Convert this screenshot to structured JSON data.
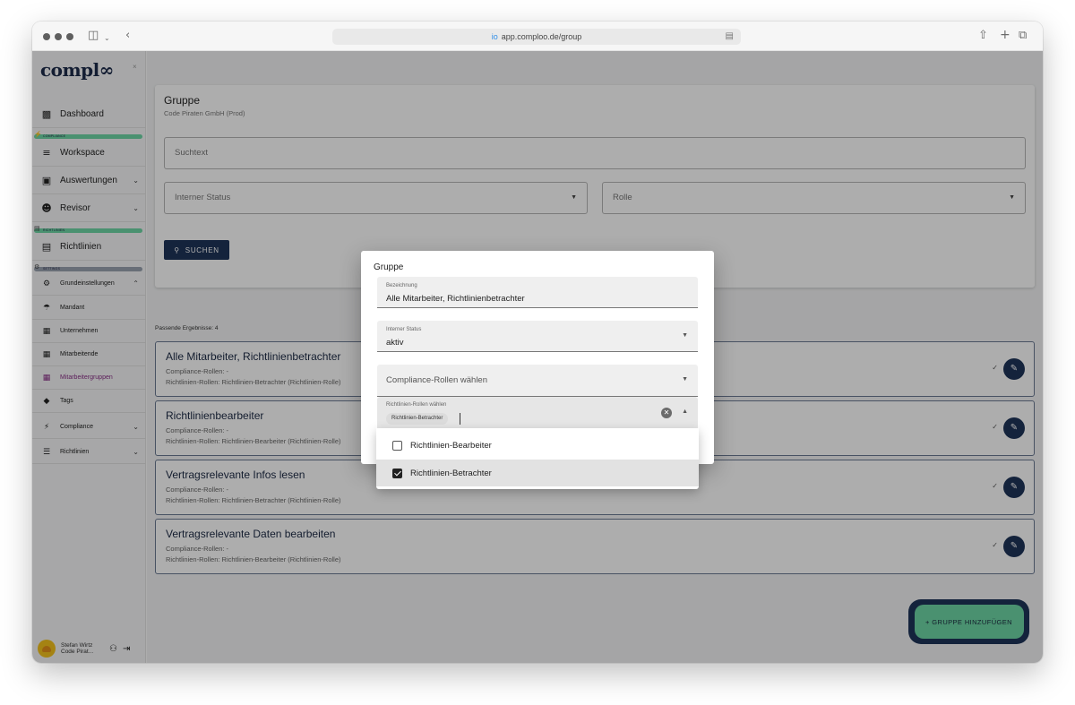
{
  "browser": {
    "url": "app.comploo.de/group",
    "favicon": "io"
  },
  "sidebar": {
    "logo": "compl∞",
    "collapse_icon": "×",
    "items": [
      {
        "label": "Dashboard",
        "icon": "dashboard-icon"
      },
      {
        "label": "Workspace",
        "icon": "workspace-icon"
      },
      {
        "label": "Auswertungen",
        "icon": "clipboard-icon"
      },
      {
        "label": "Revisor",
        "icon": "user-check-icon"
      },
      {
        "label": "Richtlinien",
        "icon": "policy-icon"
      },
      {
        "label": "Grundeinstellungen",
        "icon": "settings-icon"
      },
      {
        "label": "Mandant",
        "icon": "umbrella-icon"
      },
      {
        "label": "Unternehmen",
        "icon": "building-icon"
      },
      {
        "label": "Mitarbeitende",
        "icon": "building-icon"
      },
      {
        "label": "Mitarbeitergruppen",
        "icon": "building-icon"
      },
      {
        "label": "Tags",
        "icon": "tag-icon"
      },
      {
        "label": "Compliance",
        "icon": "bolt-icon"
      },
      {
        "label": "Richtlinien",
        "icon": "list-icon"
      }
    ],
    "sections": {
      "compliance": "COMPLIANCE",
      "richtlinien": "RICHTLINIEN",
      "settings": "SETTINGS"
    },
    "active_color": "#8a2f86",
    "section_colors": {
      "compliance": "#6ed6a5",
      "richtlinien": "#6ed6a5",
      "settings": "#9aa3b0"
    },
    "user": {
      "name": "Stefan Wirtz",
      "company": "Code Pirat..."
    }
  },
  "search": {
    "title": "Gruppe",
    "subtitle": "Code Piraten GmbH (Prod)",
    "search_placeholder": "Suchtext",
    "status_label": "Interner Status",
    "role_label": "Rolle",
    "search_button": "SUCHEN"
  },
  "results": {
    "count_label": "Passende Ergebnisse: 4",
    "items": [
      {
        "title": "Alle Mitarbeiter, Richtlinienbetrachter",
        "compliance": "Compliance-Rollen: -",
        "policy": "Richtlinien-Rollen: Richtlinien-Betrachter (Richtlinien-Rolle)"
      },
      {
        "title": "Richtlinienbearbeiter",
        "compliance": "Compliance-Rollen: -",
        "policy": "Richtlinien-Rollen: Richtlinien-Bearbeiter (Richtlinien-Rolle)"
      },
      {
        "title": "Vertragsrelevante Infos lesen",
        "compliance": "Compliance-Rollen: -",
        "policy": "Richtlinien-Rollen: Richtlinien-Betrachter (Richtlinien-Rolle)"
      },
      {
        "title": "Vertragsrelevante Daten bearbeiten",
        "compliance": "Compliance-Rollen: -",
        "policy": "Richtlinien-Rollen: Richtlinien-Bearbeiter (Richtlinien-Rolle)"
      }
    ]
  },
  "fab": {
    "label": "+ GRUPPE HINZUFÜGEN"
  },
  "dialog": {
    "title": "Gruppe",
    "name_label": "Bezeichnung",
    "name_value": "Alle Mitarbeiter, Richtlinienbetrachter",
    "status_label": "Interner Status",
    "status_value": "aktiv",
    "compliance_placeholder": "Compliance-Rollen wählen",
    "policy_label": "Richtlinien-Rollen wählen",
    "policy_chip": "Richtlinien-Betrachter",
    "options": [
      {
        "label": "Richtlinien-Bearbeiter",
        "checked": false
      },
      {
        "label": "Richtlinien-Betrachter",
        "checked": true
      }
    ]
  },
  "colors": {
    "primary": "#1e3459",
    "accent_green": "#6ed6a5"
  }
}
